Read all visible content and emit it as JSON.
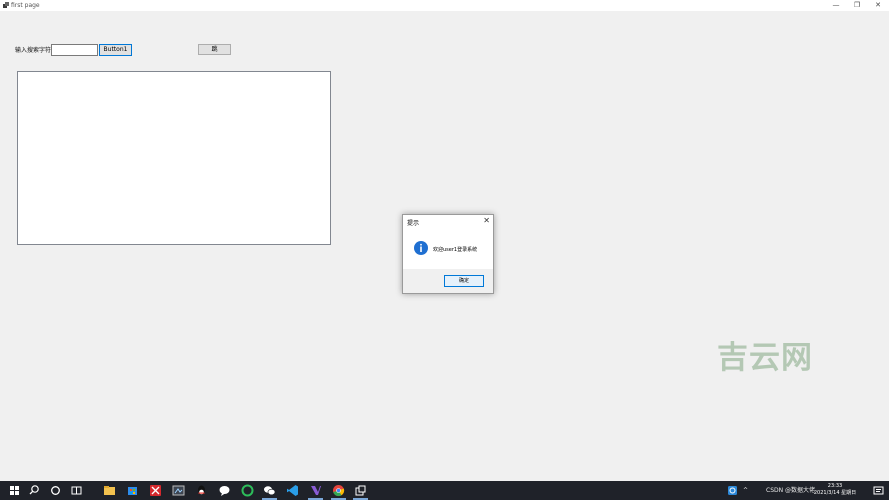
{
  "window": {
    "title": "first page",
    "minimize": "—",
    "restore": "❐",
    "close": "✕"
  },
  "form": {
    "search_label": "输入搜索字符",
    "search_value": "",
    "button1_label": "Button1",
    "button2_label": "跳"
  },
  "messagebox": {
    "title": "提示",
    "message": "欢迎user1登录系统",
    "ok_label": "确定",
    "icon": "info-icon"
  },
  "watermark": "吉云网",
  "taskbar": {
    "clock_time": "23:33",
    "clock_date": "2021/3/14 星期日",
    "tray_text": "CSDN @数据大佬",
    "apps": [
      "start",
      "search",
      "cortana",
      "task-view",
      "file-explorer",
      "store",
      "xmind",
      "snip",
      "qq",
      "chat",
      "app-green",
      "wechat",
      "vscode",
      "visual-studio",
      "chrome",
      "app-window"
    ]
  },
  "colors": {
    "accent": "#0078d7",
    "taskbar": "#1f2229",
    "info": "#1f6fd1"
  }
}
